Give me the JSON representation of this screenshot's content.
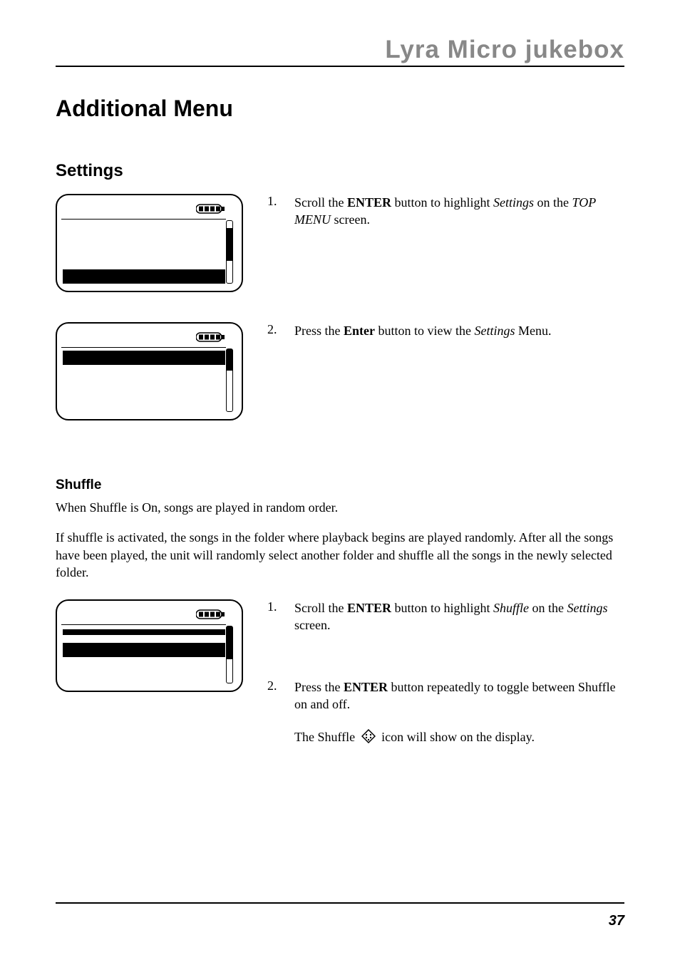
{
  "header": {
    "brand": "Lyra Micro jukebox"
  },
  "title": "Additional Menu",
  "sections": {
    "settings": {
      "heading": "Settings",
      "steps": [
        {
          "num": "1.",
          "pre": "Scroll the ",
          "bold": "ENTER",
          "mid1": " button to highlight ",
          "ital1": "Settings",
          "mid2": " on the ",
          "ital2": "TOP MENU",
          "post": " screen."
        },
        {
          "num": "2.",
          "pre": "Press the ",
          "bold": "Enter",
          "mid1": " button to view the ",
          "ital1": "Settings",
          "post": " Menu."
        }
      ]
    },
    "shuffle": {
      "heading": "Shuffle",
      "intro1": "When Shuffle is On, songs are played in random order.",
      "intro2": "If shuffle is activated, the songs in the folder where playback begins are played randomly. After all the songs have been played, the unit will randomly select another folder and shuffle all the songs in the newly selected folder.",
      "steps": [
        {
          "num": "1.",
          "pre": "Scroll the ",
          "bold": "ENTER",
          "mid1": " button to highlight ",
          "ital1": "Shuffle",
          "mid2": " on the ",
          "ital2": "Settings",
          "post": " screen."
        },
        {
          "num": "2.",
          "pre": "Press the ",
          "bold": "ENTER",
          "post": " button repeatedly to toggle between Shuffle on and off."
        }
      ],
      "note_pre": "The Shuffle ",
      "note_post": "  icon will show on the display."
    }
  },
  "page_number": "37"
}
